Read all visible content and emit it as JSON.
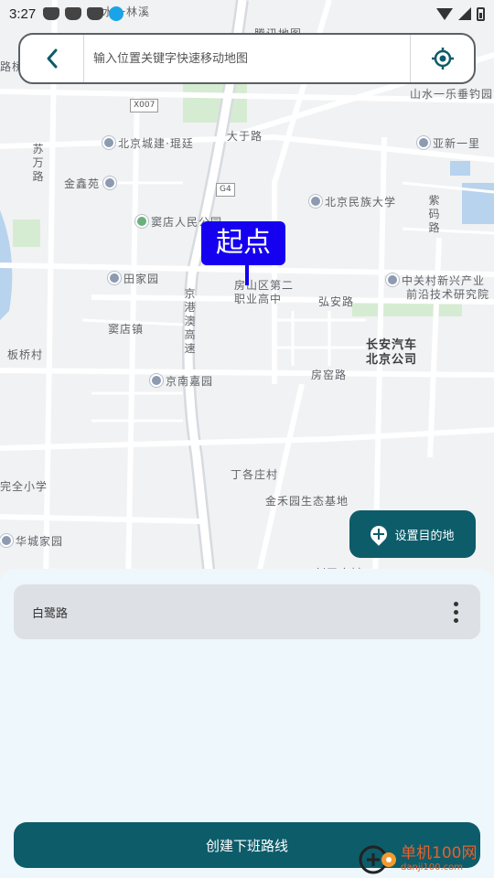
{
  "status_bar": {
    "time": "3:27"
  },
  "search": {
    "placeholder": "输入位置关键字快速移动地图"
  },
  "map": {
    "labels": [
      {
        "text": "水一林溪",
        "cls": ""
      },
      {
        "text": "腾讯地图",
        "cls": ""
      },
      {
        "text": "路桥",
        "cls": ""
      },
      {
        "text": "山水一乐垂钓园",
        "cls": ""
      },
      {
        "text": "大于路",
        "cls": ""
      },
      {
        "text": "北京城建·琨廷",
        "cls": ""
      },
      {
        "text": "亚新一里",
        "cls": ""
      },
      {
        "text": "苏万路",
        "cls": "vert"
      },
      {
        "text": "金鑫苑",
        "cls": ""
      },
      {
        "text": "北京民族大学",
        "cls": ""
      },
      {
        "text": "紫码路",
        "cls": "vert"
      },
      {
        "text": "窦店人民公园",
        "cls": ""
      },
      {
        "text": "田家园",
        "cls": ""
      },
      {
        "text": "房山区第二",
        "cls": ""
      },
      {
        "text": "职业高中",
        "cls": ""
      },
      {
        "text": "弘安路",
        "cls": ""
      },
      {
        "text": "中关村新兴产业",
        "cls": ""
      },
      {
        "text": "前沿技术研究院",
        "cls": ""
      },
      {
        "text": "京港澳高速",
        "cls": "vert"
      },
      {
        "text": "窦店镇",
        "cls": ""
      },
      {
        "text": "长安汽车",
        "cls": "dark"
      },
      {
        "text": "北京公司",
        "cls": "dark"
      },
      {
        "text": "板桥村",
        "cls": ""
      },
      {
        "text": "房窑路",
        "cls": ""
      },
      {
        "text": "京南嘉园",
        "cls": ""
      },
      {
        "text": "丁各庄村",
        "cls": ""
      },
      {
        "text": "完全小学",
        "cls": ""
      },
      {
        "text": "金禾园生态基地",
        "cls": ""
      },
      {
        "text": "华城家园",
        "cls": ""
      },
      {
        "text": "刘平庄村",
        "cls": ""
      }
    ],
    "badges": [
      "X007",
      "G4"
    ]
  },
  "marker": {
    "label": "起点"
  },
  "buttons": {
    "set_destination": "设置目的地",
    "create_route": "创建下班路线"
  },
  "route_card": {
    "name": "白鹭路"
  },
  "watermark": {
    "main": "单机100网",
    "sub": "danji100.com"
  },
  "colors": {
    "primary": "#0d5c6a",
    "marker": "#1500f0",
    "sheet_bg": "#eef7fb",
    "card_bg": "#dde0e4"
  }
}
